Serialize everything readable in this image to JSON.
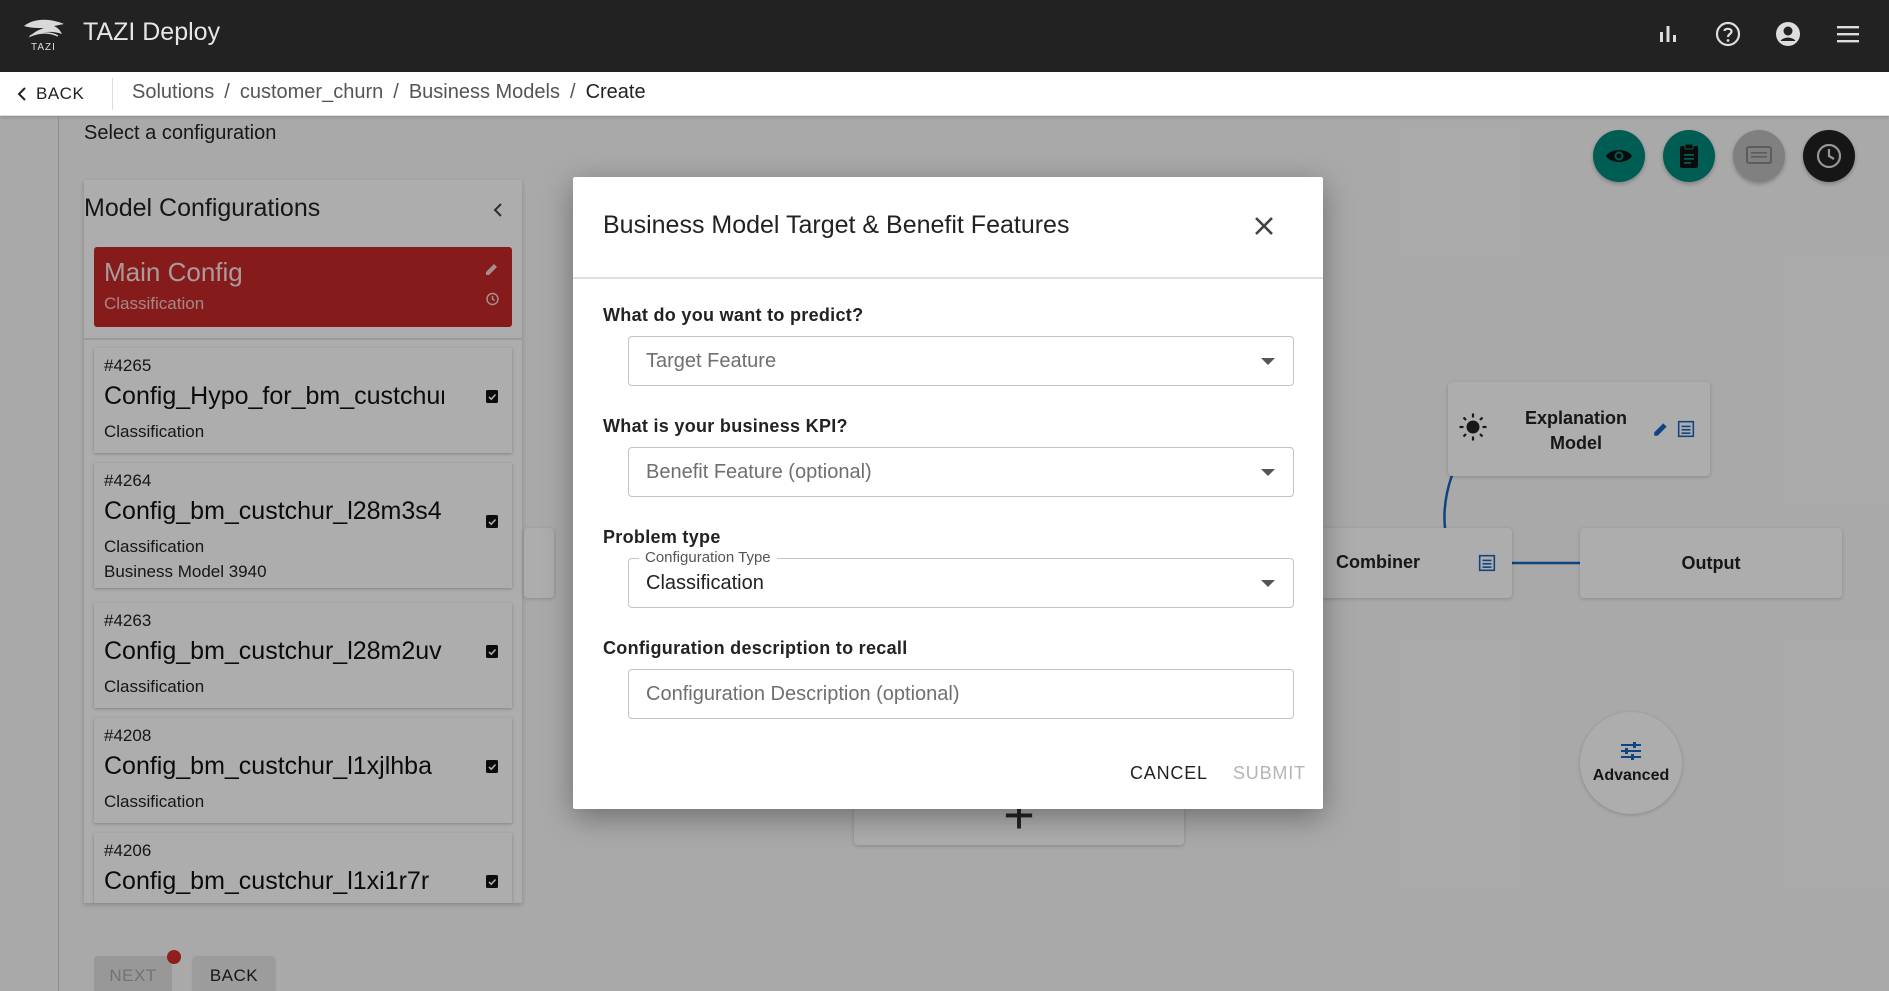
{
  "app": {
    "logo_text": "TAZI",
    "title": "TAZI Deploy"
  },
  "header_icons": [
    "bar-chart-icon",
    "help-icon",
    "account-icon",
    "menu-icon"
  ],
  "breadcrumb": {
    "back_label": "BACK",
    "items": [
      "Solutions",
      "customer_churn",
      "Business Models",
      "Create"
    ],
    "separator": "/"
  },
  "page": {
    "select_label": "Select a configuration"
  },
  "panel": {
    "title": "Model Configurations",
    "main_config": {
      "name": "Main Config",
      "type": "Classification"
    },
    "configs": [
      {
        "id": "#4265",
        "name": "Config_Hypo_for_bm_custchurn",
        "type": "Classification",
        "business_model": ""
      },
      {
        "id": "#4264",
        "name": "Config_bm_custchur_l28m3s4",
        "type": "Classification",
        "business_model": "Business Model 3940"
      },
      {
        "id": "#4263",
        "name": "Config_bm_custchur_l28m2uv",
        "type": "Classification",
        "business_model": ""
      },
      {
        "id": "#4208",
        "name": "Config_bm_custchur_l1xjlhba",
        "type": "Classification",
        "business_model": ""
      },
      {
        "id": "#4206",
        "name": "Config_bm_custchur_l1xi1r7r",
        "type": "Classification",
        "business_model": ""
      }
    ]
  },
  "footer_buttons": {
    "next": "NEXT",
    "back": "BACK"
  },
  "canvas": {
    "nodes": {
      "explanation": [
        "Explanation",
        "Model"
      ],
      "combiner": "Combiner",
      "output": "Output",
      "advanced": "Advanced",
      "plus": "+"
    },
    "fab_colors": {
      "teal": "#00897b",
      "grey": "#bdbdbd",
      "dark": "#212121"
    }
  },
  "dialog": {
    "title": "Business Model Target & Benefit Features",
    "q1": "What do you want to predict?",
    "target_placeholder": "Target Feature",
    "q2": "What is your business KPI?",
    "benefit_placeholder": "Benefit Feature (optional)",
    "q3": "Problem type",
    "config_type_label": "Configuration Type",
    "config_type_value": "Classification",
    "q4": "Configuration description to recall",
    "description_placeholder": "Configuration Description (optional)",
    "cancel": "CANCEL",
    "submit": "SUBMIT"
  },
  "colors": {
    "appbar": "#222222",
    "main_config": "#c62828",
    "teal": "#00897b",
    "link_blue": "#1565c0"
  }
}
